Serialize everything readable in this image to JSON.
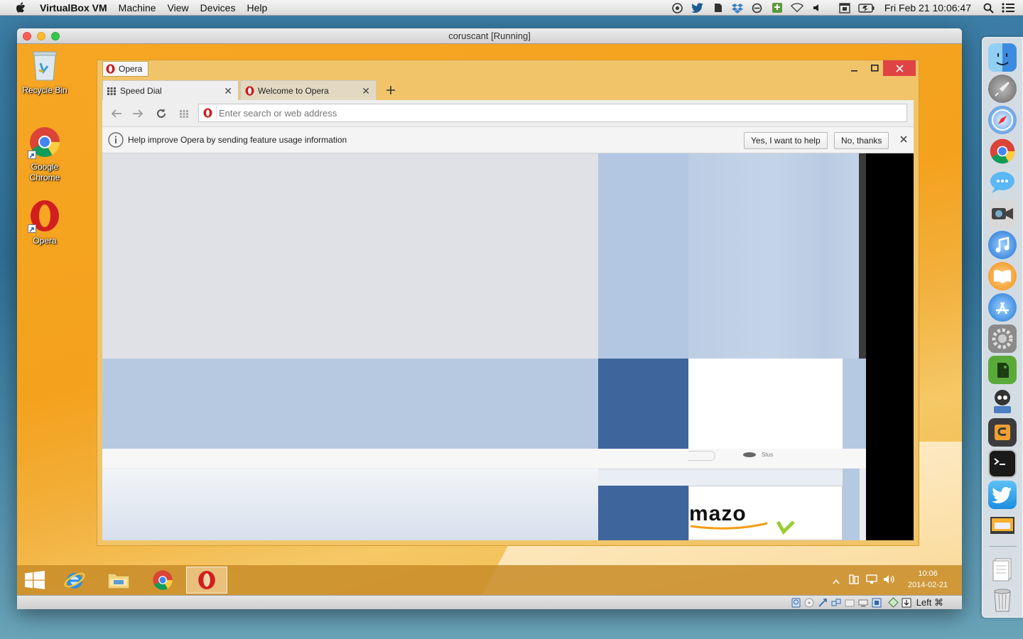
{
  "menubar": {
    "app_name": "VirtualBox VM",
    "menus": [
      "Machine",
      "View",
      "Devices",
      "Help"
    ],
    "clock": "Fri Feb 21  10:06:47"
  },
  "vbox": {
    "title": "coruscant [Running]",
    "host_key": "Left ⌘"
  },
  "desktop": {
    "icons": [
      "Recycle Bin",
      "Google Chrome",
      "Opera"
    ]
  },
  "opera": {
    "frame_title": "Opera",
    "tabs": [
      {
        "label": "Speed Dial"
      },
      {
        "label": "Welcome to Opera"
      }
    ],
    "address_placeholder": "Enter search or web address",
    "infobar": {
      "message": "Help improve Opera by sending feature usage information",
      "yes_label": "Yes, I want to help",
      "no_label": "No, thanks"
    },
    "page_fragment": {
      "status_text": "Stus",
      "logo_text": "mazo"
    }
  },
  "taskbar": {
    "time": "10:06",
    "date": "2014-02-21"
  },
  "colors": {
    "win8_background": "#f6a623",
    "opera_red": "#cc1b1b",
    "infobar_bg": "#f4f4f4",
    "tile_blue": "#3f659d",
    "tile_light_blue": "#b6c8e0"
  }
}
